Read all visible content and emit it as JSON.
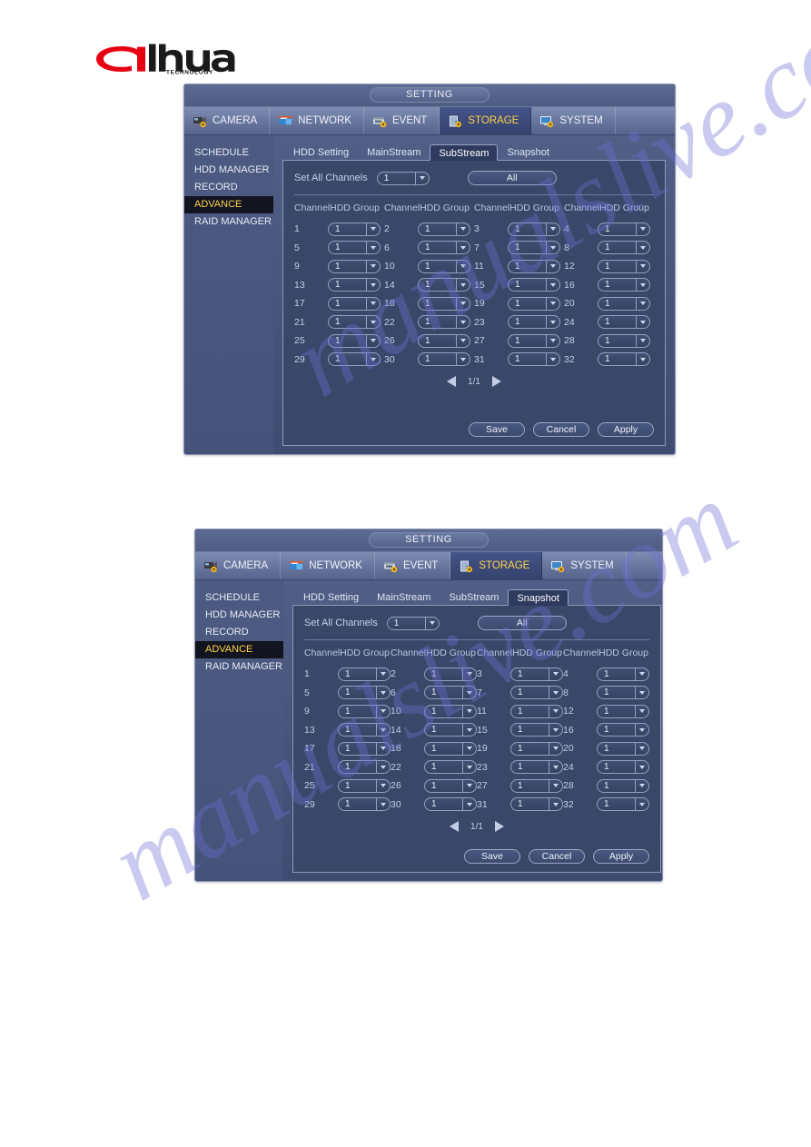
{
  "brand": {
    "name": "alhua",
    "wordmark": "dahua",
    "tagline": "TECHNOLOGY",
    "logo_red": "#e60012",
    "logo_dark": "#1a1a1a"
  },
  "watermark": {
    "text": "manualslive.com",
    "color": "#6f6fd8"
  },
  "colors": {
    "accent_yellow": "#ffd24d",
    "window_blue": "#4b597f",
    "panel_blue": "#394868",
    "selected_nav": "#3b4978",
    "label_blue": "#b9c6e6"
  },
  "window": {
    "title": "SETTING",
    "nav": [
      {
        "label": "CAMERA",
        "icon": "camera-icon",
        "selected": false
      },
      {
        "label": "NETWORK",
        "icon": "network-icon",
        "selected": false
      },
      {
        "label": "EVENT",
        "icon": "event-icon",
        "selected": false
      },
      {
        "label": "STORAGE",
        "icon": "storage-icon",
        "selected": true
      },
      {
        "label": "SYSTEM",
        "icon": "system-icon",
        "selected": false
      }
    ],
    "sidebar": [
      {
        "label": "SCHEDULE",
        "selected": false
      },
      {
        "label": "HDD MANAGER",
        "selected": false
      },
      {
        "label": "RECORD",
        "selected": false
      },
      {
        "label": "ADVANCE",
        "selected": true
      },
      {
        "label": "RAID MANAGER",
        "selected": false
      }
    ],
    "tabs": [
      {
        "label": "HDD Setting"
      },
      {
        "label": "MainStream"
      },
      {
        "label": "SubStream"
      },
      {
        "label": "Snapshot"
      }
    ]
  },
  "figures": [
    {
      "active_tab": "SubStream",
      "set_all_label": "Set All Channels",
      "set_all_value": "1",
      "all_button": "All",
      "column_header_channel": "Channel",
      "column_header_group": "HDD Group",
      "page_indicator": "1/1",
      "buttons": {
        "save": "Save",
        "cancel": "Cancel",
        "apply": "Apply"
      },
      "channels": [
        {
          "ch": "1",
          "group": "1"
        },
        {
          "ch": "2",
          "group": "1"
        },
        {
          "ch": "3",
          "group": "1"
        },
        {
          "ch": "4",
          "group": "1"
        },
        {
          "ch": "5",
          "group": "1"
        },
        {
          "ch": "6",
          "group": "1"
        },
        {
          "ch": "7",
          "group": "1"
        },
        {
          "ch": "8",
          "group": "1"
        },
        {
          "ch": "9",
          "group": "1"
        },
        {
          "ch": "10",
          "group": "1"
        },
        {
          "ch": "11",
          "group": "1"
        },
        {
          "ch": "12",
          "group": "1"
        },
        {
          "ch": "13",
          "group": "1"
        },
        {
          "ch": "14",
          "group": "1"
        },
        {
          "ch": "15",
          "group": "1"
        },
        {
          "ch": "16",
          "group": "1"
        },
        {
          "ch": "17",
          "group": "1"
        },
        {
          "ch": "18",
          "group": "1"
        },
        {
          "ch": "19",
          "group": "1"
        },
        {
          "ch": "20",
          "group": "1"
        },
        {
          "ch": "21",
          "group": "1"
        },
        {
          "ch": "22",
          "group": "1"
        },
        {
          "ch": "23",
          "group": "1"
        },
        {
          "ch": "24",
          "group": "1"
        },
        {
          "ch": "25",
          "group": "1"
        },
        {
          "ch": "26",
          "group": "1"
        },
        {
          "ch": "27",
          "group": "1"
        },
        {
          "ch": "28",
          "group": "1"
        },
        {
          "ch": "29",
          "group": "1"
        },
        {
          "ch": "30",
          "group": "1"
        },
        {
          "ch": "31",
          "group": "1"
        },
        {
          "ch": "32",
          "group": "1"
        }
      ]
    },
    {
      "active_tab": "Snapshot",
      "set_all_label": "Set All Channels",
      "set_all_value": "1",
      "all_button": "All",
      "column_header_channel": "Channel",
      "column_header_group": "HDD Group",
      "page_indicator": "1/1",
      "buttons": {
        "save": "Save",
        "cancel": "Cancel",
        "apply": "Apply"
      },
      "channels": [
        {
          "ch": "1",
          "group": "1"
        },
        {
          "ch": "2",
          "group": "1"
        },
        {
          "ch": "3",
          "group": "1"
        },
        {
          "ch": "4",
          "group": "1"
        },
        {
          "ch": "5",
          "group": "1"
        },
        {
          "ch": "6",
          "group": "1"
        },
        {
          "ch": "7",
          "group": "1"
        },
        {
          "ch": "8",
          "group": "1"
        },
        {
          "ch": "9",
          "group": "1"
        },
        {
          "ch": "10",
          "group": "1"
        },
        {
          "ch": "11",
          "group": "1"
        },
        {
          "ch": "12",
          "group": "1"
        },
        {
          "ch": "13",
          "group": "1"
        },
        {
          "ch": "14",
          "group": "1"
        },
        {
          "ch": "15",
          "group": "1"
        },
        {
          "ch": "16",
          "group": "1"
        },
        {
          "ch": "17",
          "group": "1"
        },
        {
          "ch": "18",
          "group": "1"
        },
        {
          "ch": "19",
          "group": "1"
        },
        {
          "ch": "20",
          "group": "1"
        },
        {
          "ch": "21",
          "group": "1"
        },
        {
          "ch": "22",
          "group": "1"
        },
        {
          "ch": "23",
          "group": "1"
        },
        {
          "ch": "24",
          "group": "1"
        },
        {
          "ch": "25",
          "group": "1"
        },
        {
          "ch": "26",
          "group": "1"
        },
        {
          "ch": "27",
          "group": "1"
        },
        {
          "ch": "28",
          "group": "1"
        },
        {
          "ch": "29",
          "group": "1"
        },
        {
          "ch": "30",
          "group": "1"
        },
        {
          "ch": "31",
          "group": "1"
        },
        {
          "ch": "32",
          "group": "1"
        }
      ]
    }
  ]
}
